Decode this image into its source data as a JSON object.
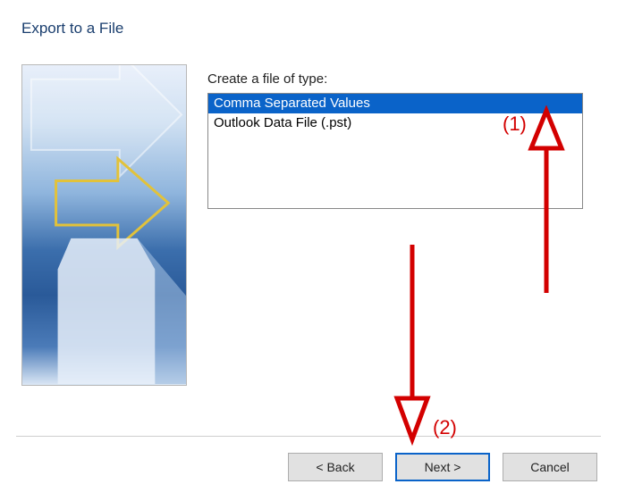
{
  "dialog": {
    "title": "Export to a File"
  },
  "list": {
    "label": "Create a file of type:",
    "items": [
      {
        "label": "Comma Separated Values",
        "selected": true
      },
      {
        "label": "Outlook Data File (.pst)",
        "selected": false
      }
    ]
  },
  "buttons": {
    "back": "< Back",
    "next": "Next >",
    "cancel": "Cancel"
  },
  "annotations": {
    "label1": "(1)",
    "label2": "(2)"
  },
  "colors": {
    "accent": "#0a63c9",
    "annotation": "#d30000"
  }
}
